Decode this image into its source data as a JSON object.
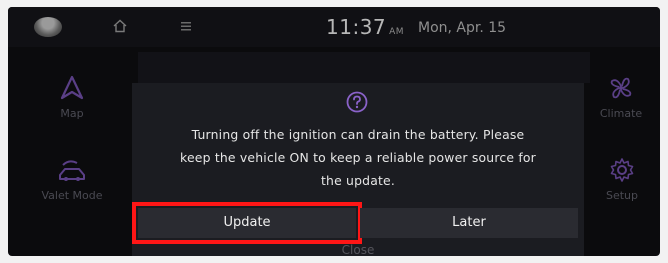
{
  "status_bar": {
    "time": "11:37",
    "ampm": "AM",
    "date": "Mon, Apr. 15"
  },
  "side_menu": {
    "left": [
      {
        "label": "Map",
        "icon": "navigation-arrow-icon"
      },
      {
        "label": "Valet Mode",
        "icon": "valet-car-icon"
      }
    ],
    "right": [
      {
        "label": "Climate",
        "icon": "fan-icon"
      },
      {
        "label": "Setup",
        "icon": "gear-icon"
      }
    ]
  },
  "dialog": {
    "icon": "question-icon",
    "message_line1": "Turning off the ignition can drain the battery. Please",
    "message_line2": "keep the vehicle ON to keep a reliable power source for",
    "message_line3": "the update.",
    "update_label": "Update",
    "later_label": "Later",
    "close_label": "Close"
  },
  "colors": {
    "highlight": "#ff1616",
    "icon_accent": "#8a62c9"
  }
}
